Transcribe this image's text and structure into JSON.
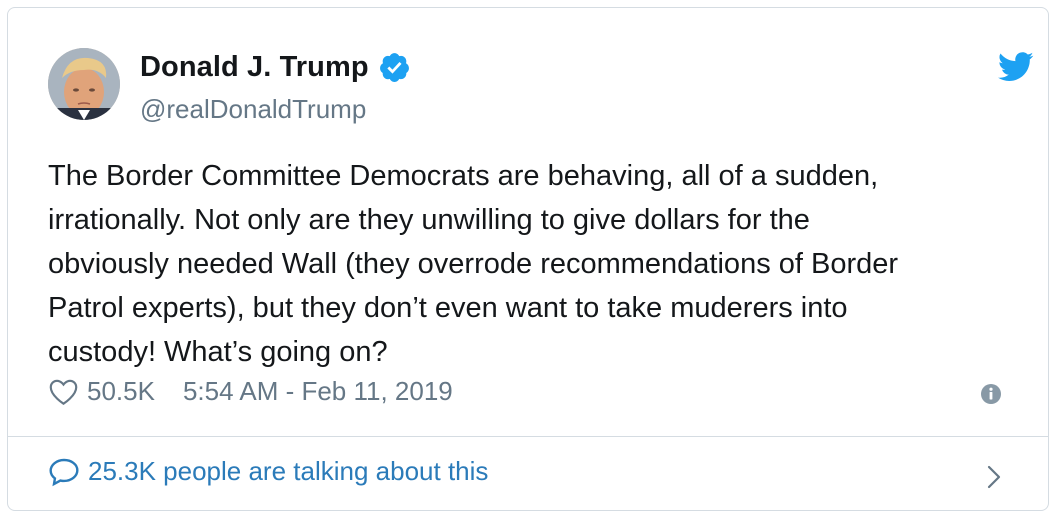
{
  "tweet": {
    "author": {
      "display_name": "Donald J. Trump",
      "handle": "@realDonaldTrump",
      "verified": true,
      "avatar_icon": "profile-photo"
    },
    "text": "The Border Committee Democrats are behaving, all of a sudden,\nirrationally. Not only are they unwilling to give dollars for the\nobviously needed Wall (they overrode recommendations of Border\nPatrol experts), but they don’t even want to take muderers into\ncustody! What’s going on?",
    "likes": "50.5K",
    "timestamp": "5:54 AM - Feb 11, 2019",
    "conversation_text": "25.3K people are talking about this"
  },
  "icons": {
    "brand": "twitter-bird-icon",
    "verified": "verified-badge-icon",
    "like": "heart-icon",
    "info": "info-icon",
    "reply": "speech-bubble-icon",
    "more": "chevron-right-icon"
  },
  "colors": {
    "text": "#14171a",
    "secondary": "#657786",
    "brand_blue": "#1da1f2",
    "link_blue": "#2b7bb9",
    "border": "#d5dce2"
  }
}
